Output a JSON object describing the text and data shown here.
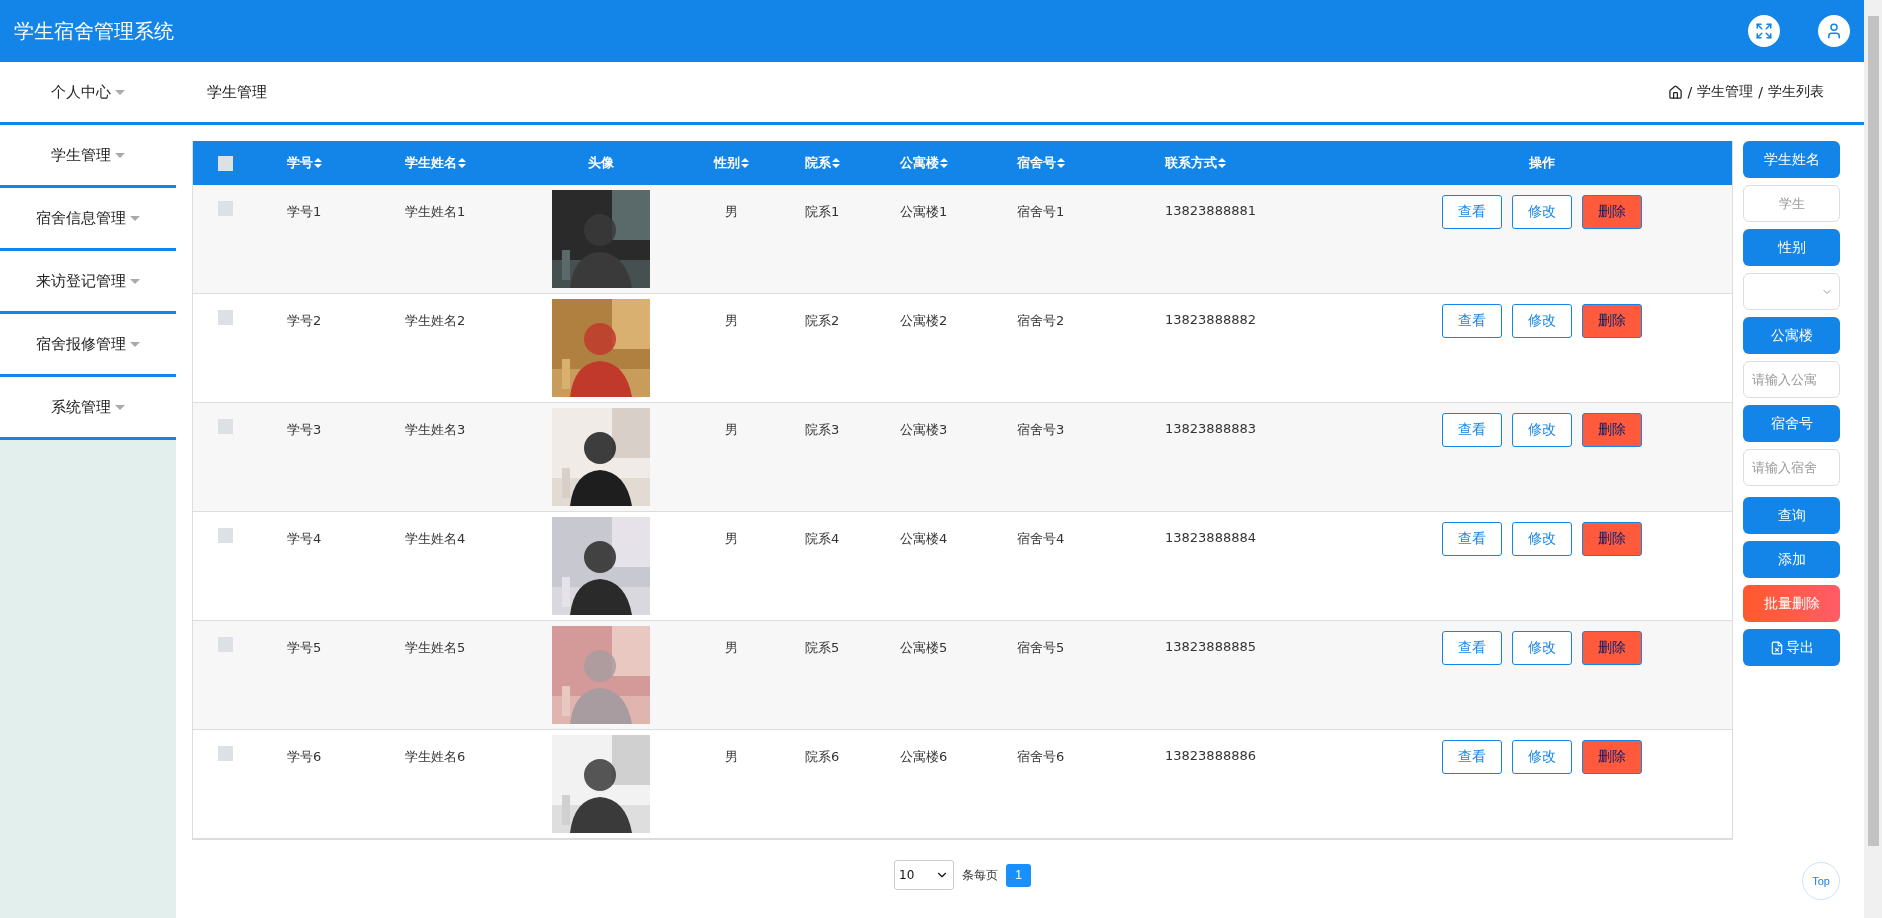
{
  "header": {
    "title": "学生宿舍管理系统"
  },
  "sidebar": {
    "items": [
      {
        "label": "个人中心"
      },
      {
        "label": "学生管理"
      },
      {
        "label": "宿舍信息管理"
      },
      {
        "label": "来访登记管理"
      },
      {
        "label": "宿舍报修管理"
      },
      {
        "label": "系统管理"
      }
    ]
  },
  "page_title": "学生管理",
  "breadcrumb": {
    "separator": "/",
    "items": [
      "学生管理",
      "学生列表"
    ]
  },
  "table": {
    "header_checked": false,
    "columns": [
      {
        "label": "学号",
        "sortable": true
      },
      {
        "label": "学生姓名",
        "sortable": true
      },
      {
        "label": "头像",
        "sortable": false
      },
      {
        "label": "性别",
        "sortable": true
      },
      {
        "label": "院系",
        "sortable": true
      },
      {
        "label": "公寓楼",
        "sortable": true
      },
      {
        "label": "宿舍号",
        "sortable": true
      },
      {
        "label": "联系方式",
        "sortable": true
      },
      {
        "label": "操作",
        "sortable": false
      }
    ],
    "rows": [
      {
        "checked": false,
        "student_id": "学号1",
        "name": "学生姓名1",
        "gender": "男",
        "department": "院系1",
        "building": "公寓楼1",
        "room": "宿舍号1",
        "phone": "13823888881",
        "actions": [
          {
            "label": "查看",
            "kind": "outline"
          },
          {
            "label": "修改",
            "kind": "outline"
          },
          {
            "label": "删除",
            "kind": "danger"
          }
        ]
      },
      {
        "checked": false,
        "student_id": "学号2",
        "name": "学生姓名2",
        "gender": "男",
        "department": "院系2",
        "building": "公寓楼2",
        "room": "宿舍号2",
        "phone": "13823888882",
        "actions": [
          {
            "label": "查看",
            "kind": "outline"
          },
          {
            "label": "修改",
            "kind": "outline"
          },
          {
            "label": "删除",
            "kind": "danger"
          }
        ]
      },
      {
        "checked": false,
        "student_id": "学号3",
        "name": "学生姓名3",
        "gender": "男",
        "department": "院系3",
        "building": "公寓楼3",
        "room": "宿舍号3",
        "phone": "13823888883",
        "actions": [
          {
            "label": "查看",
            "kind": "outline"
          },
          {
            "label": "修改",
            "kind": "outline"
          },
          {
            "label": "删除",
            "kind": "danger"
          }
        ]
      },
      {
        "checked": false,
        "student_id": "学号4",
        "name": "学生姓名4",
        "gender": "男",
        "department": "院系4",
        "building": "公寓楼4",
        "room": "宿舍号4",
        "phone": "13823888884",
        "actions": [
          {
            "label": "查看",
            "kind": "outline"
          },
          {
            "label": "修改",
            "kind": "outline"
          },
          {
            "label": "删除",
            "kind": "danger"
          }
        ]
      },
      {
        "checked": false,
        "student_id": "学号5",
        "name": "学生姓名5",
        "gender": "男",
        "department": "院系5",
        "building": "公寓楼5",
        "room": "宿舍号5",
        "phone": "13823888885",
        "actions": [
          {
            "label": "查看",
            "kind": "outline"
          },
          {
            "label": "修改",
            "kind": "outline"
          },
          {
            "label": "删除",
            "kind": "danger"
          }
        ]
      },
      {
        "checked": false,
        "student_id": "学号6",
        "name": "学生姓名6",
        "gender": "男",
        "department": "院系6",
        "building": "公寓楼6",
        "room": "宿舍号6",
        "phone": "13823888886",
        "actions": [
          {
            "label": "查看",
            "kind": "outline"
          },
          {
            "label": "修改",
            "kind": "outline"
          },
          {
            "label": "删除",
            "kind": "danger"
          }
        ]
      }
    ]
  },
  "filters": [
    {
      "kind": "label",
      "text": "学生姓名"
    },
    {
      "kind": "input",
      "placeholder": "学生"
    },
    {
      "kind": "label",
      "text": "性别"
    },
    {
      "kind": "select"
    },
    {
      "kind": "label",
      "text": "公寓楼"
    },
    {
      "kind": "input",
      "placeholder": "请输入公寓"
    },
    {
      "kind": "label",
      "text": "宿舍号"
    },
    {
      "kind": "input",
      "placeholder": "请输入宿舍"
    },
    {
      "kind": "button",
      "text": "查询"
    },
    {
      "kind": "button",
      "text": "添加"
    },
    {
      "kind": "danger",
      "text": "批量删除"
    },
    {
      "kind": "export",
      "text": "导出"
    }
  ],
  "pagination": {
    "page_size": "10",
    "per_page_label": "条每页",
    "pages": [
      {
        "label": "1",
        "selected": true
      }
    ]
  },
  "back_to_top": "Top"
}
